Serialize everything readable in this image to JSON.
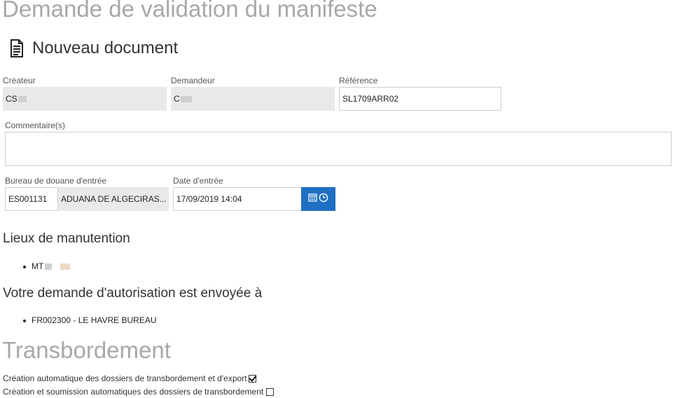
{
  "page_title": "Demande de validation du manifeste",
  "document_heading": {
    "icon": "document-icon",
    "label": "Nouveau document"
  },
  "form": {
    "createur": {
      "label": "Créateur",
      "value": "CS"
    },
    "demandeur": {
      "label": "Demandeur",
      "value": "C"
    },
    "reference": {
      "label": "Référence",
      "value": "SL1709ARR02"
    },
    "commentaire": {
      "label": "Commentaire(s)",
      "value": ""
    },
    "bureau": {
      "label": "Bureau de douane d'entrée",
      "code": "ES001131",
      "name": "ADUANA DE ALGECIRAS..."
    },
    "date_entree": {
      "label": "Date d'entrée",
      "value": "17/09/2019 14:04",
      "icons": [
        "calendar-icon",
        "clock-icon"
      ],
      "button_color": "#1f6fc3"
    }
  },
  "lieux": {
    "heading": "Lieux de manutention",
    "items": [
      "MT"
    ]
  },
  "envoi": {
    "heading": "Votre demande d'autorisation est envoyée à",
    "items": [
      "FR002300 - LE HAVRE BUREAU"
    ]
  },
  "transbordement": {
    "heading": "Transbordement",
    "options": [
      {
        "label": "Création automatique des dossiers de transbordement et d'export",
        "checked": true
      },
      {
        "label": "Création et soumission automatiques des dossiers de transbordement",
        "checked": false
      }
    ]
  }
}
